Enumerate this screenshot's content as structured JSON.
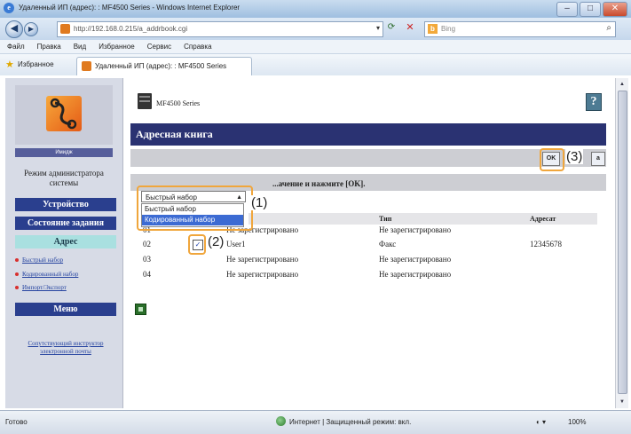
{
  "window": {
    "title": "Удаленный ИП (адрес): : MF4500 Series - Windows Internet Explorer",
    "buttons": {
      "minimize": "–",
      "maximize": "□",
      "close": "✕"
    }
  },
  "nav": {
    "url": "http://192.168.0.215/a_addrbook.cgi",
    "search_placeholder": "Bing"
  },
  "menu": [
    "Файл",
    "Правка",
    "Вид",
    "Избранное",
    "Сервис",
    "Справка"
  ],
  "favorites": {
    "label": "Избранное",
    "tab_title": "Удаленный ИП (адрес): : MF4500 Series"
  },
  "sidebar": {
    "device_label": "Имидж",
    "mode": "Режим администратора системы",
    "device_btn": "Устройство",
    "jobs_btn": "Состояние задания",
    "address_btn": "Адрес",
    "links": [
      "Быстрый набор",
      "Кодированный набор",
      "Импорт/Экспорт"
    ],
    "menu_btn": "Меню",
    "bottom_link": "Сопутствующий инструктор электронной почты"
  },
  "content": {
    "series": "MF4500 Series",
    "help": "?",
    "page_title": "Адресная книга",
    "ok_button": "OK",
    "cancel_button": "а",
    "instruction": "...ачение и нажмите [OK].",
    "select_value": "Быстрый набор",
    "select_options": [
      "Быстрый набор",
      "Кодированный набор"
    ],
    "callouts": [
      "(1)",
      "(2)",
      "(3)"
    ],
    "columns": {
      "type": "Тип",
      "dest": "Адресат"
    },
    "rows": [
      {
        "num": "01",
        "checked": false,
        "name": "Не зарегистрировано",
        "type": "Не зарегистрировано",
        "dest": ""
      },
      {
        "num": "02",
        "checked": true,
        "name": "User1",
        "type": "Факс",
        "dest": "12345678"
      },
      {
        "num": "03",
        "checked": false,
        "name": "Не зарегистрировано",
        "type": "Не зарегистрировано",
        "dest": ""
      },
      {
        "num": "04",
        "checked": false,
        "name": "Не зарегистрировано",
        "type": "Не зарегистрировано",
        "dest": ""
      }
    ],
    "check_mark": "✓"
  },
  "status": {
    "done": "Готово",
    "zone": "Интернет | Защищенный режим: вкл.",
    "zoom": "100%",
    "tools": "◐ ▾"
  }
}
